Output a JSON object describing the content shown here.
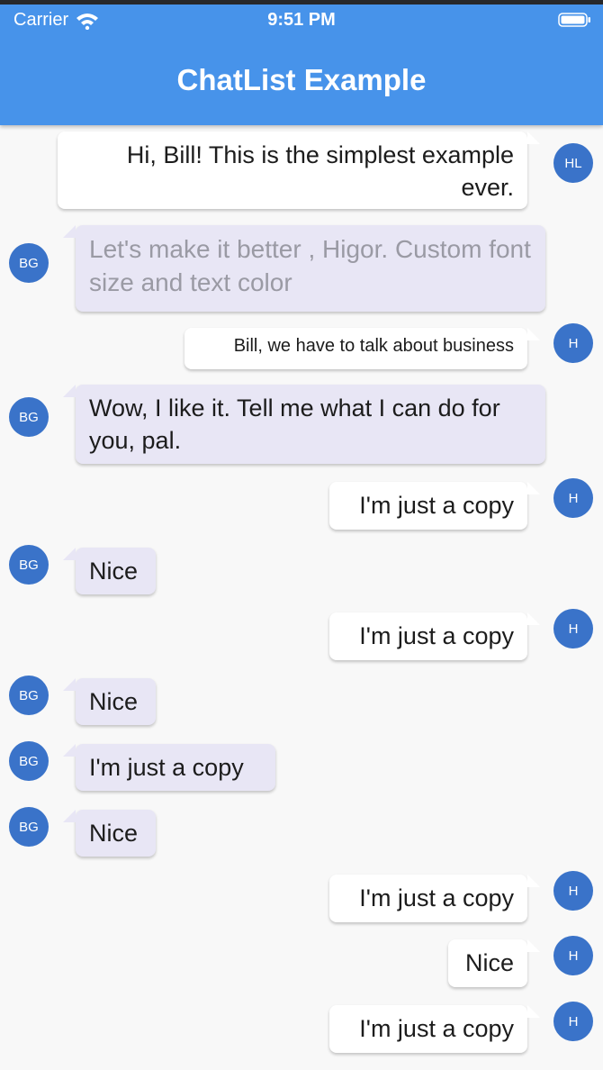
{
  "status_bar": {
    "carrier": "Carrier",
    "time": "9:51 PM",
    "icons": [
      "wifi-icon",
      "battery-icon"
    ]
  },
  "app_bar": {
    "title": "ChatList Example",
    "color": "#4793ea"
  },
  "colors": {
    "avatar": "#3a73c9",
    "incoming_bubble": "#e8e6f5",
    "outgoing_bubble": "#ffffff",
    "background": "#f8f8f8"
  },
  "messages": [
    {
      "direction": "out",
      "avatar": "HL",
      "text": "Hi, Bill! This is the simplest example ever."
    },
    {
      "direction": "in",
      "avatar": "BG",
      "text": "Let's make it better , Higor. Custom font size and text color"
    },
    {
      "direction": "out",
      "avatar": "H",
      "text": "Bill, we have to talk about business"
    },
    {
      "direction": "in",
      "avatar": "BG",
      "text": "Wow, I like it. Tell me what I can do for you, pal."
    },
    {
      "direction": "out",
      "avatar": "H",
      "text": "I'm just a copy"
    },
    {
      "direction": "in",
      "avatar": "BG",
      "text": "Nice"
    },
    {
      "direction": "out",
      "avatar": "H",
      "text": "I'm just a copy"
    },
    {
      "direction": "in",
      "avatar": "BG",
      "text": "Nice"
    },
    {
      "direction": "in",
      "avatar": "BG",
      "text": "I'm just a copy"
    },
    {
      "direction": "in",
      "avatar": "BG",
      "text": "Nice"
    },
    {
      "direction": "out",
      "avatar": "H",
      "text": "I'm just a copy"
    },
    {
      "direction": "out",
      "avatar": "H",
      "text": "Nice"
    },
    {
      "direction": "out",
      "avatar": "H",
      "text": "I'm just a copy"
    }
  ]
}
